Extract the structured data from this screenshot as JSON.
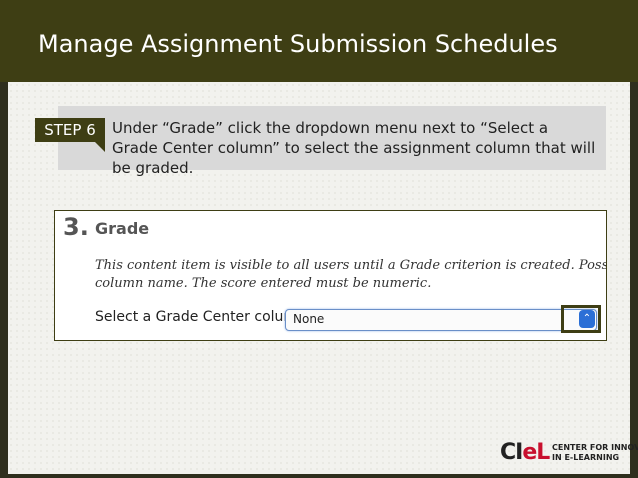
{
  "slide": {
    "title": "Manage Assignment Submission Schedules"
  },
  "step": {
    "badge": "STEP 6",
    "text": "Under “Grade” click the dropdown menu next to “Select a Grade Center column” to select the assignment column that will be graded."
  },
  "screenshot": {
    "section_number": "3.",
    "section_title": "Grade",
    "description_line1": "This content item is visible to all users until a Grade criterion is created. Possible points for",
    "description_line2": "column name. The score entered must be numeric.",
    "select_label": "Select a Grade Center column",
    "select_value": "None"
  },
  "footer": {
    "logo_mark": "CI",
    "logo_mark_accent": "eL",
    "logo_text_line1": "CENTER FOR INNOVATION",
    "logo_text_line2": "IN E-LEARNING"
  },
  "colors": {
    "header": "#3e3e14",
    "accent": "#2b6fd6"
  }
}
